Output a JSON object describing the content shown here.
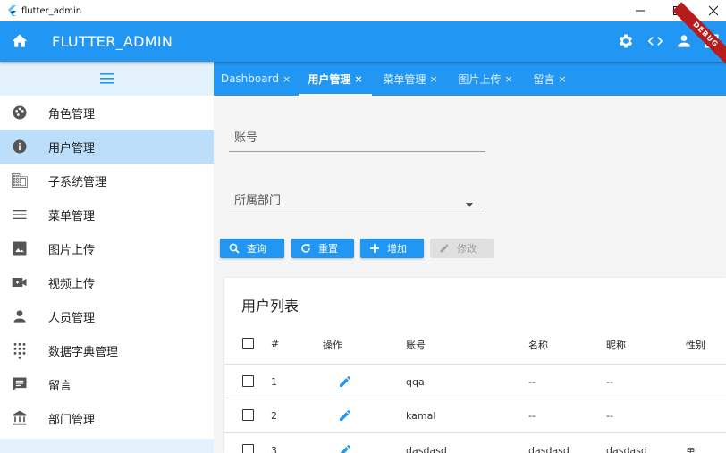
{
  "window": {
    "title": "flutter_admin"
  },
  "appbar": {
    "title": "FLUTTER_ADMIN",
    "debug_label": "DEBUG"
  },
  "colors": {
    "primary": "#2196f3",
    "sidebar_active": "#bbdefb",
    "sidebar_header": "#e3f2fd",
    "debug": "#b71c1c"
  },
  "sidebar": {
    "items": [
      {
        "label": "角色管理",
        "icon": "palette-icon"
      },
      {
        "label": "用户管理",
        "icon": "info-icon",
        "active": true
      },
      {
        "label": "子系统管理",
        "icon": "domain-icon"
      },
      {
        "label": "菜单管理",
        "icon": "menu-icon"
      },
      {
        "label": "图片上传",
        "icon": "image-icon"
      },
      {
        "label": "视频上传",
        "icon": "video-icon"
      },
      {
        "label": "人员管理",
        "icon": "person-icon"
      },
      {
        "label": "数据字典管理",
        "icon": "dialpad-icon"
      },
      {
        "label": "留言",
        "icon": "comment-icon"
      },
      {
        "label": "部门管理",
        "icon": "account-balance-icon"
      }
    ]
  },
  "tabs": [
    {
      "label": "Dashboard",
      "close": "×"
    },
    {
      "label": "用户管理",
      "close": "×",
      "active": true
    },
    {
      "label": "菜单管理",
      "close": "×"
    },
    {
      "label": "图片上传",
      "close": "×"
    },
    {
      "label": "留言",
      "close": "×"
    }
  ],
  "form": {
    "account_label": "账号",
    "department_label": "所属部门"
  },
  "buttons": {
    "query": "查询",
    "reset": "重置",
    "add": "增加",
    "edit": "修改"
  },
  "table": {
    "title": "用户列表",
    "headers": {
      "index": "#",
      "action": "操作",
      "account": "账号",
      "name": "名称",
      "nickname": "昵称",
      "gender": "性别"
    },
    "rows": [
      {
        "index": "1",
        "account": "qqa",
        "name": "--",
        "nickname": "--",
        "gender": ""
      },
      {
        "index": "2",
        "account": "kamal",
        "name": "--",
        "nickname": "--",
        "gender": ""
      },
      {
        "index": "3",
        "account": "dasdasd",
        "name": "dasdasd",
        "nickname": "dasdasd",
        "gender": "男"
      }
    ]
  }
}
